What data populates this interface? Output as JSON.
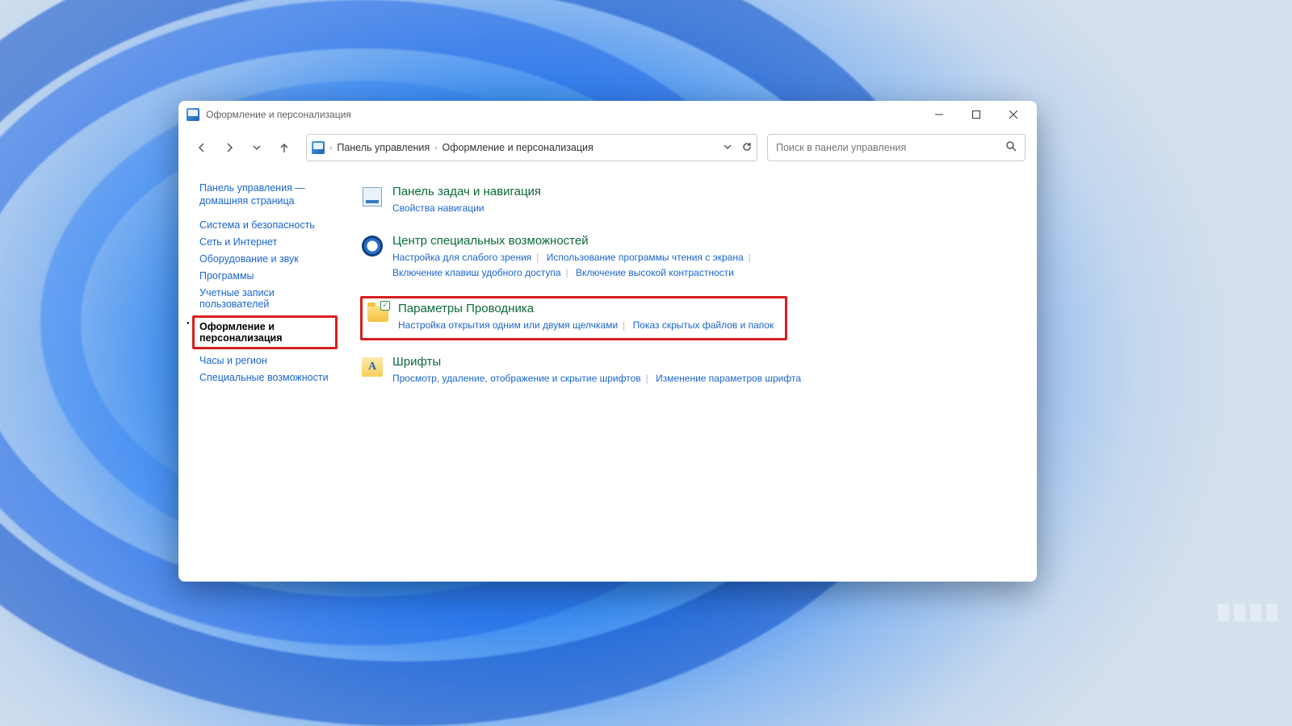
{
  "window": {
    "title": "Оформление и персонализация"
  },
  "breadcrumb": {
    "root": "Панель управления",
    "current": "Оформление и персонализация"
  },
  "search": {
    "placeholder": "Поиск в панели управления"
  },
  "sidebar": {
    "home": "Панель управления — домашняя страница",
    "items": [
      "Система и безопасность",
      "Сеть и Интернет",
      "Оборудование и звук",
      "Программы",
      "Учетные записи пользователей",
      "Оформление и персонализация",
      "Часы и регион",
      "Специальные возможности"
    ],
    "active_index": 5
  },
  "sections": [
    {
      "heading": "Панель задач и навигация",
      "links": [
        "Свойства навигации"
      ]
    },
    {
      "heading": "Центр специальных возможностей",
      "links": [
        "Настройка для слабого зрения",
        "Использование программы чтения с экрана",
        "Включение клавиш удобного доступа",
        "Включение высокой контрастности"
      ]
    },
    {
      "heading": "Параметры Проводника",
      "links": [
        "Настройка открытия одним или двумя щелчками",
        "Показ скрытых файлов и папок"
      ],
      "highlighted": true
    },
    {
      "heading": "Шрифты",
      "links": [
        "Просмотр, удаление, отображение и скрытие шрифтов",
        "Изменение параметров шрифта"
      ]
    }
  ]
}
